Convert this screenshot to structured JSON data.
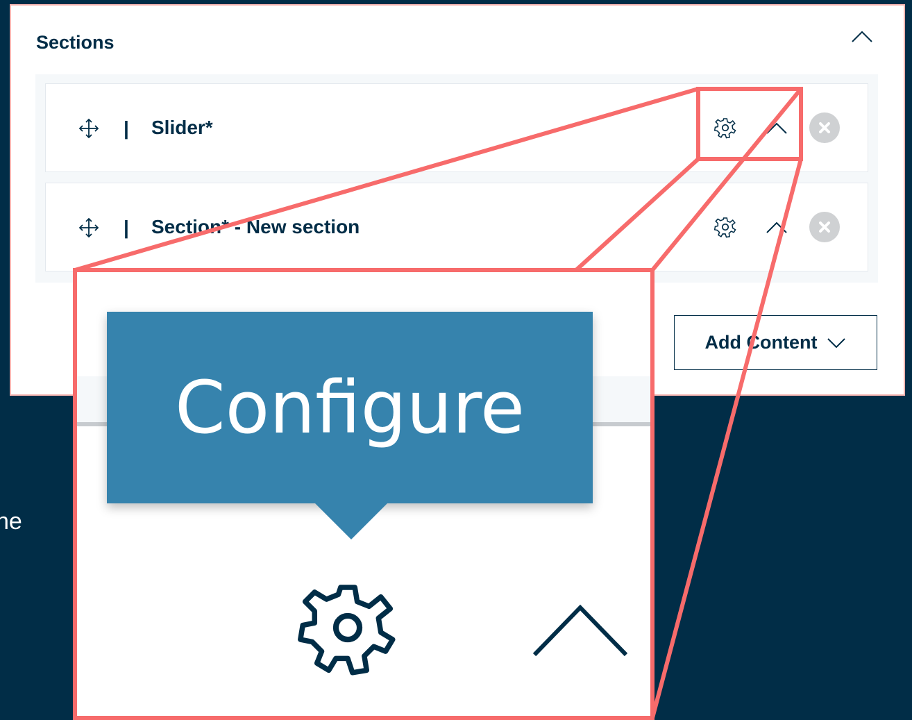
{
  "panel": {
    "title": "Sections"
  },
  "rows": [
    {
      "label": "Slider*",
      "separator": "|"
    },
    {
      "label": "Section* - New section",
      "separator": "|"
    }
  ],
  "add_content": {
    "label": "Add Content"
  },
  "background_text": "ne",
  "zoom": {
    "tooltip": "Configure"
  },
  "colors": {
    "background": "#012d47",
    "text_dark": "#012d47",
    "tooltip": "#3683ad",
    "highlight": "#f76b6b",
    "remove_button": "#cfd1d3"
  },
  "icons": {
    "collapse": "chevron-up-icon",
    "drag": "move-arrows-icon",
    "configure": "gear-icon",
    "toggle": "chevron-up-icon",
    "remove": "close-circle-icon",
    "dropdown": "chevron-down-icon"
  }
}
